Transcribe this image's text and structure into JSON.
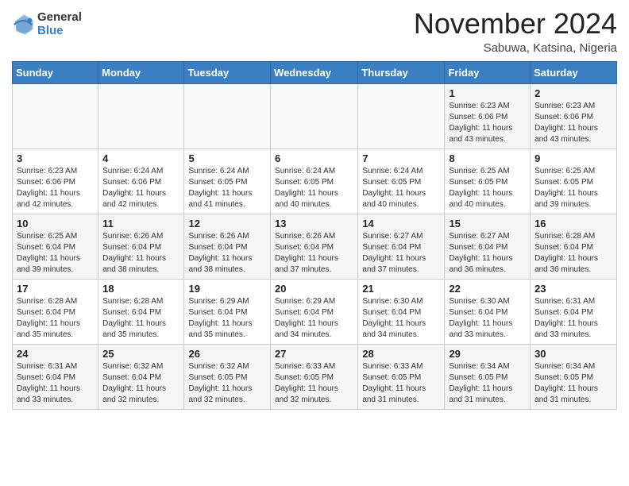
{
  "header": {
    "logo_general": "General",
    "logo_blue": "Blue",
    "month_title": "November 2024",
    "location": "Sabuwa, Katsina, Nigeria"
  },
  "calendar": {
    "days_of_week": [
      "Sunday",
      "Monday",
      "Tuesday",
      "Wednesday",
      "Thursday",
      "Friday",
      "Saturday"
    ],
    "weeks": [
      [
        {
          "day": "",
          "info": ""
        },
        {
          "day": "",
          "info": ""
        },
        {
          "day": "",
          "info": ""
        },
        {
          "day": "",
          "info": ""
        },
        {
          "day": "",
          "info": ""
        },
        {
          "day": "1",
          "info": "Sunrise: 6:23 AM\nSunset: 6:06 PM\nDaylight: 11 hours\nand 43 minutes."
        },
        {
          "day": "2",
          "info": "Sunrise: 6:23 AM\nSunset: 6:06 PM\nDaylight: 11 hours\nand 43 minutes."
        }
      ],
      [
        {
          "day": "3",
          "info": "Sunrise: 6:23 AM\nSunset: 6:06 PM\nDaylight: 11 hours\nand 42 minutes."
        },
        {
          "day": "4",
          "info": "Sunrise: 6:24 AM\nSunset: 6:06 PM\nDaylight: 11 hours\nand 42 minutes."
        },
        {
          "day": "5",
          "info": "Sunrise: 6:24 AM\nSunset: 6:05 PM\nDaylight: 11 hours\nand 41 minutes."
        },
        {
          "day": "6",
          "info": "Sunrise: 6:24 AM\nSunset: 6:05 PM\nDaylight: 11 hours\nand 40 minutes."
        },
        {
          "day": "7",
          "info": "Sunrise: 6:24 AM\nSunset: 6:05 PM\nDaylight: 11 hours\nand 40 minutes."
        },
        {
          "day": "8",
          "info": "Sunrise: 6:25 AM\nSunset: 6:05 PM\nDaylight: 11 hours\nand 40 minutes."
        },
        {
          "day": "9",
          "info": "Sunrise: 6:25 AM\nSunset: 6:05 PM\nDaylight: 11 hours\nand 39 minutes."
        }
      ],
      [
        {
          "day": "10",
          "info": "Sunrise: 6:25 AM\nSunset: 6:04 PM\nDaylight: 11 hours\nand 39 minutes."
        },
        {
          "day": "11",
          "info": "Sunrise: 6:26 AM\nSunset: 6:04 PM\nDaylight: 11 hours\nand 38 minutes."
        },
        {
          "day": "12",
          "info": "Sunrise: 6:26 AM\nSunset: 6:04 PM\nDaylight: 11 hours\nand 38 minutes."
        },
        {
          "day": "13",
          "info": "Sunrise: 6:26 AM\nSunset: 6:04 PM\nDaylight: 11 hours\nand 37 minutes."
        },
        {
          "day": "14",
          "info": "Sunrise: 6:27 AM\nSunset: 6:04 PM\nDaylight: 11 hours\nand 37 minutes."
        },
        {
          "day": "15",
          "info": "Sunrise: 6:27 AM\nSunset: 6:04 PM\nDaylight: 11 hours\nand 36 minutes."
        },
        {
          "day": "16",
          "info": "Sunrise: 6:28 AM\nSunset: 6:04 PM\nDaylight: 11 hours\nand 36 minutes."
        }
      ],
      [
        {
          "day": "17",
          "info": "Sunrise: 6:28 AM\nSunset: 6:04 PM\nDaylight: 11 hours\nand 35 minutes."
        },
        {
          "day": "18",
          "info": "Sunrise: 6:28 AM\nSunset: 6:04 PM\nDaylight: 11 hours\nand 35 minutes."
        },
        {
          "day": "19",
          "info": "Sunrise: 6:29 AM\nSunset: 6:04 PM\nDaylight: 11 hours\nand 35 minutes."
        },
        {
          "day": "20",
          "info": "Sunrise: 6:29 AM\nSunset: 6:04 PM\nDaylight: 11 hours\nand 34 minutes."
        },
        {
          "day": "21",
          "info": "Sunrise: 6:30 AM\nSunset: 6:04 PM\nDaylight: 11 hours\nand 34 minutes."
        },
        {
          "day": "22",
          "info": "Sunrise: 6:30 AM\nSunset: 6:04 PM\nDaylight: 11 hours\nand 33 minutes."
        },
        {
          "day": "23",
          "info": "Sunrise: 6:31 AM\nSunset: 6:04 PM\nDaylight: 11 hours\nand 33 minutes."
        }
      ],
      [
        {
          "day": "24",
          "info": "Sunrise: 6:31 AM\nSunset: 6:04 PM\nDaylight: 11 hours\nand 33 minutes."
        },
        {
          "day": "25",
          "info": "Sunrise: 6:32 AM\nSunset: 6:04 PM\nDaylight: 11 hours\nand 32 minutes."
        },
        {
          "day": "26",
          "info": "Sunrise: 6:32 AM\nSunset: 6:05 PM\nDaylight: 11 hours\nand 32 minutes."
        },
        {
          "day": "27",
          "info": "Sunrise: 6:33 AM\nSunset: 6:05 PM\nDaylight: 11 hours\nand 32 minutes."
        },
        {
          "day": "28",
          "info": "Sunrise: 6:33 AM\nSunset: 6:05 PM\nDaylight: 11 hours\nand 31 minutes."
        },
        {
          "day": "29",
          "info": "Sunrise: 6:34 AM\nSunset: 6:05 PM\nDaylight: 11 hours\nand 31 minutes."
        },
        {
          "day": "30",
          "info": "Sunrise: 6:34 AM\nSunset: 6:05 PM\nDaylight: 11 hours\nand 31 minutes."
        }
      ]
    ]
  }
}
